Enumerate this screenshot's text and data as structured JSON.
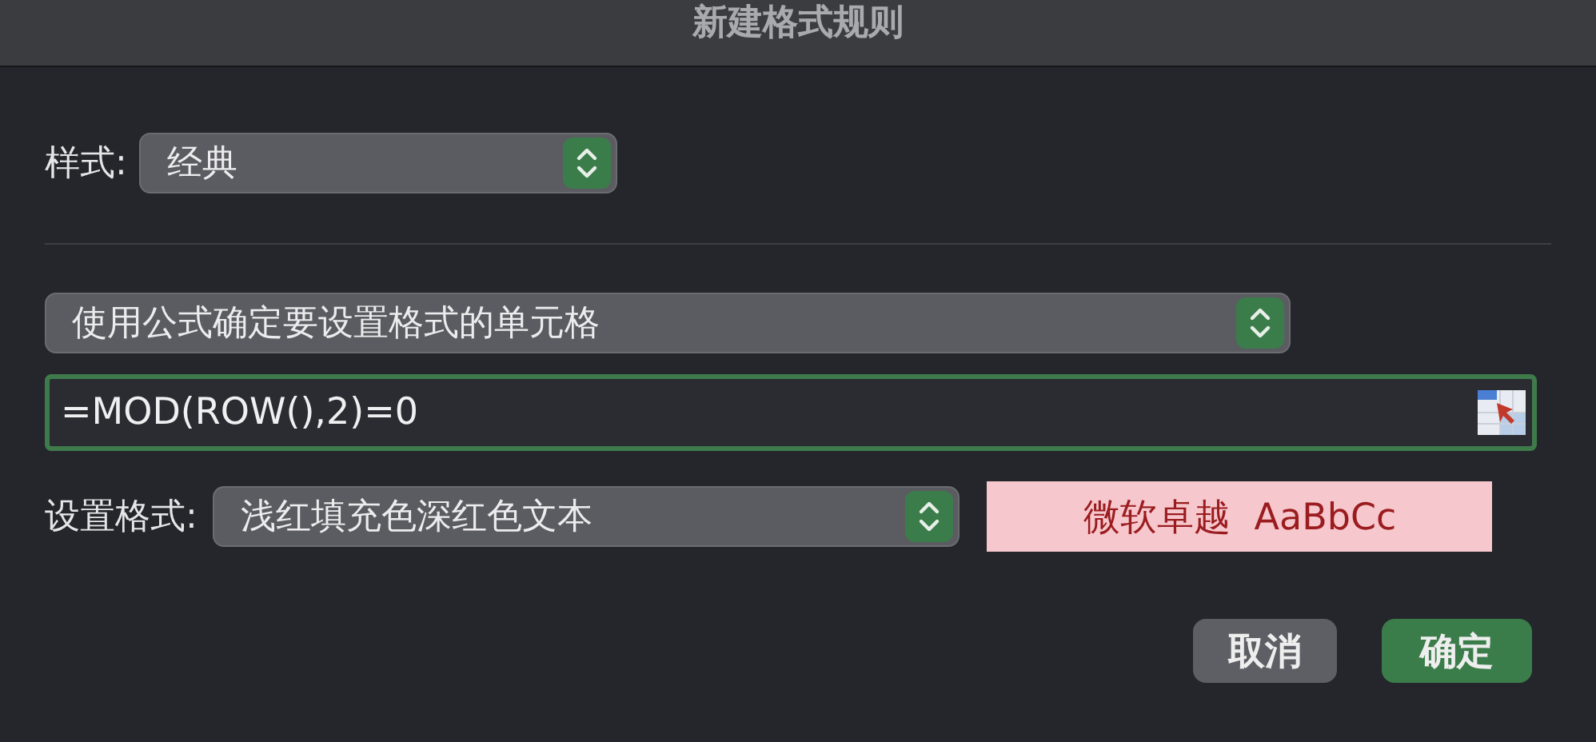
{
  "window": {
    "title": "新建格式规则"
  },
  "style": {
    "label": "样式:",
    "value": "经典"
  },
  "rule_type": {
    "value": "使用公式确定要设置格式的单元格"
  },
  "formula": {
    "value": "=MOD(ROW(),2)=0"
  },
  "format": {
    "label": "设置格式:",
    "value": "浅红填充色深红色文本",
    "preview": "微软卓越  AaBbCc"
  },
  "buttons": [
    {
      "label": "取消",
      "kind": "secondary"
    },
    {
      "label": "确定",
      "kind": "primary"
    }
  ]
}
